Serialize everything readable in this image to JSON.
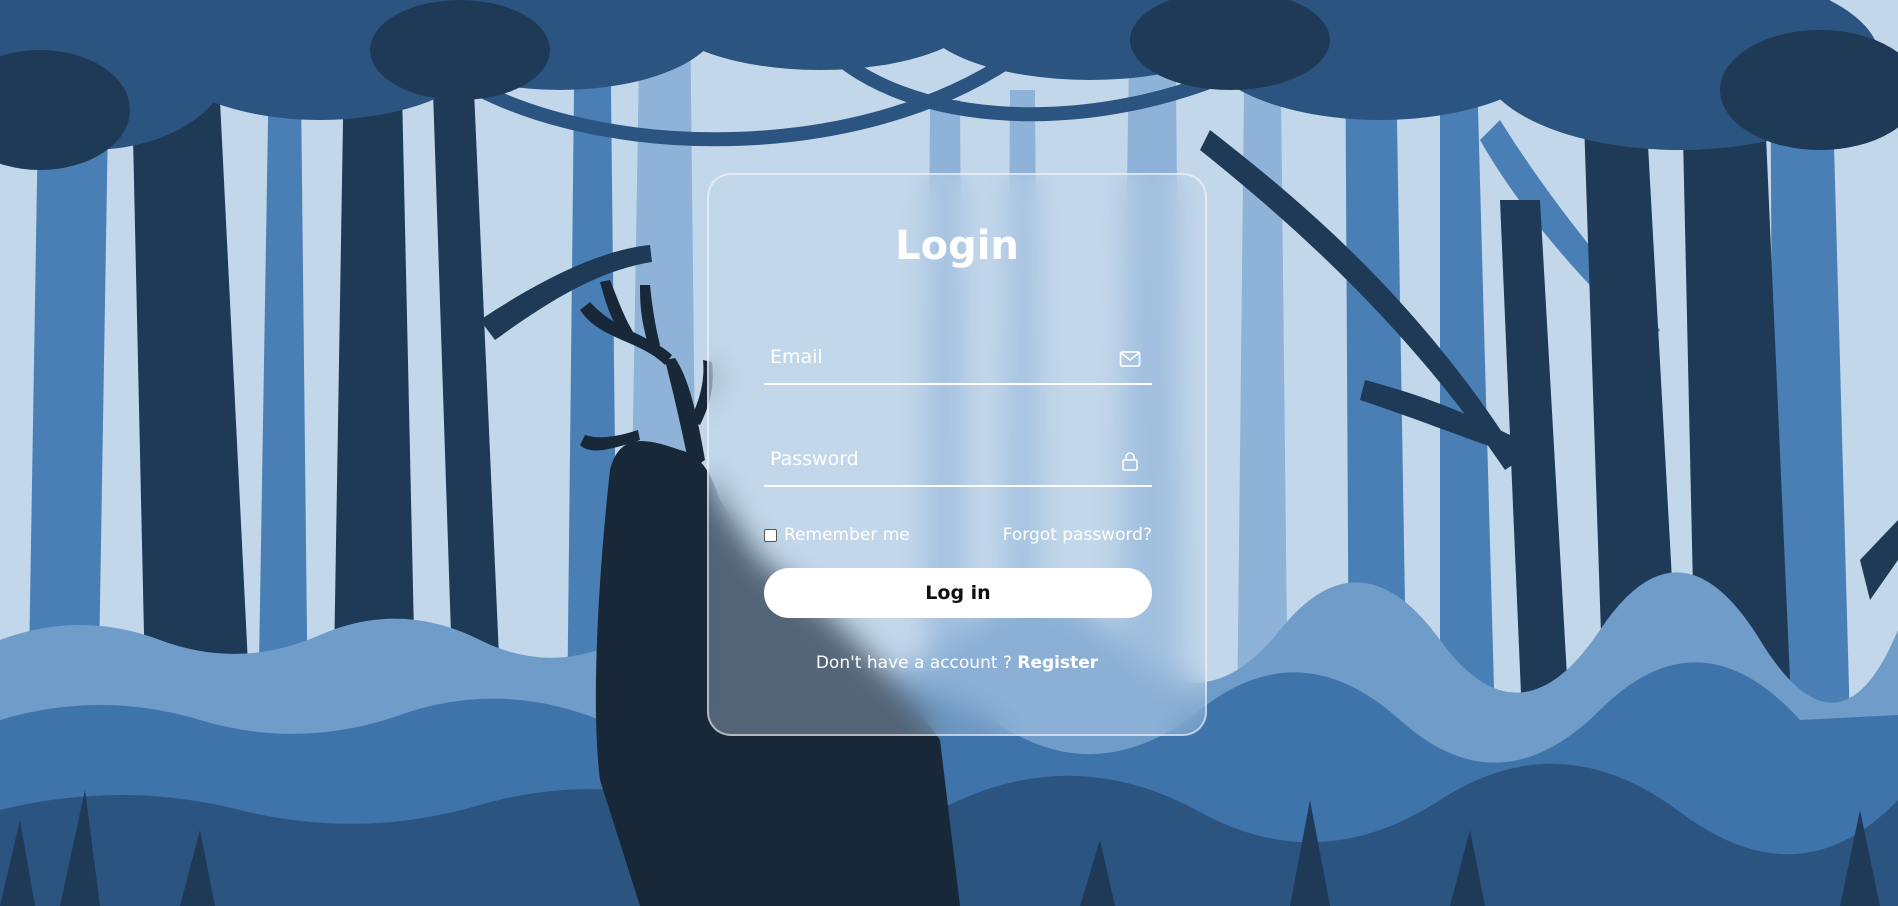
{
  "login_form": {
    "title": "Login",
    "email": {
      "placeholder": "Email",
      "value": "",
      "icon": "envelope-icon"
    },
    "password": {
      "placeholder": "Password",
      "value": "",
      "icon": "lock-icon"
    },
    "remember_label": "Remember me",
    "remember_checked": false,
    "forgot_label": "Forgot password?",
    "submit_label": "Log in",
    "register_prompt": "Don't have a account ?",
    "register_link": "Register"
  },
  "colors": {
    "sky": "#c3d7ea",
    "far_trees": "#7ba3cc",
    "mid_trees": "#4a7fb5",
    "dark_trees": "#1e3a57",
    "silhouette": "#182838",
    "button_bg": "#ffffff",
    "text": "#ffffff"
  }
}
